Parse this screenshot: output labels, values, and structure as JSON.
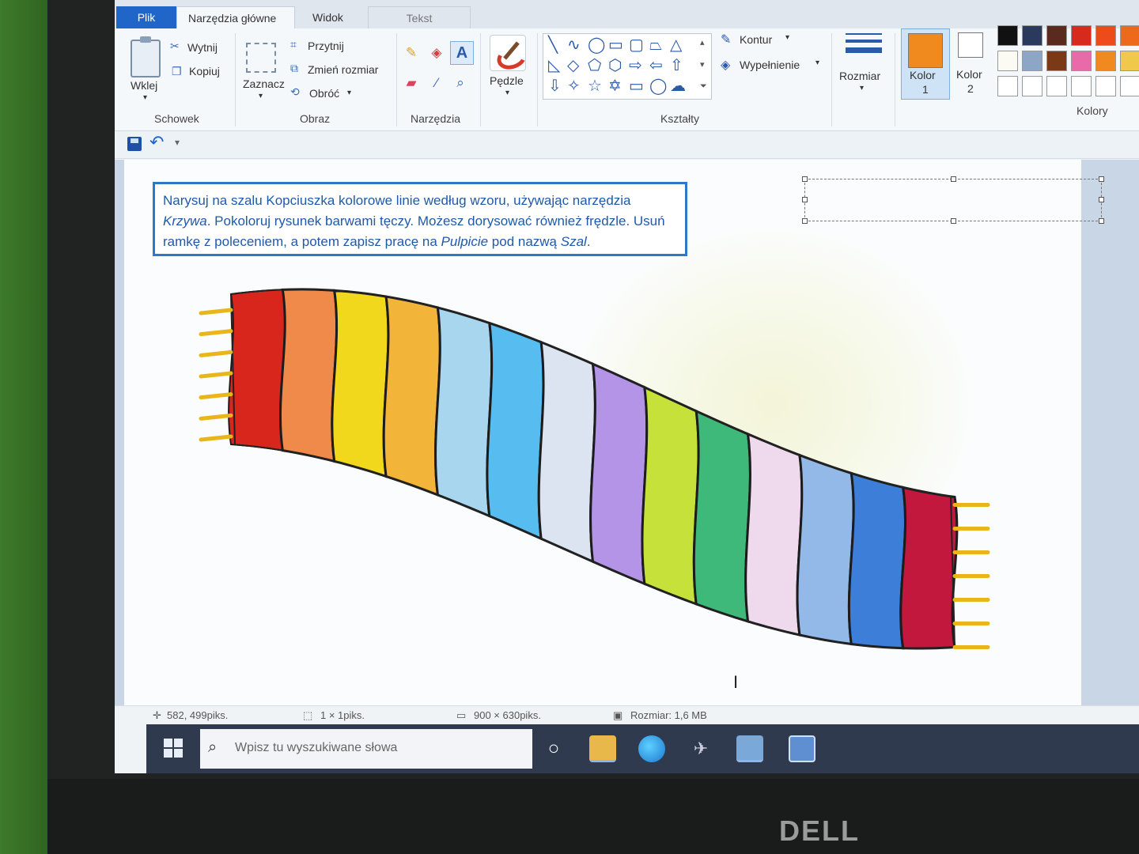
{
  "brand": "DELL",
  "tabs": {
    "file": "Plik",
    "home": "Narzędzia główne",
    "view": "Widok",
    "text": "Tekst"
  },
  "ribbon": {
    "clipboard": {
      "paste": "Wklej",
      "cut": "Wytnij",
      "copy": "Kopiuj",
      "label": "Schowek"
    },
    "image": {
      "select": "Zaznacz",
      "crop": "Przytnij",
      "resize": "Zmień rozmiar",
      "rotate": "Obróć",
      "label": "Obraz"
    },
    "tools": {
      "label": "Narzędzia",
      "text_tool": "A"
    },
    "brushes": "Pędzle",
    "shapes": {
      "outline": "Kontur",
      "fill": "Wypełnienie",
      "label": "Kształty"
    },
    "size": "Rozmiar",
    "color1": {
      "line1": "Kolor",
      "line2": "1",
      "value": "#f0891e"
    },
    "color2": {
      "line1": "Kolor",
      "line2": "2",
      "value": "#ffffff"
    },
    "colors_label": "Kolory",
    "palette": [
      "#111111",
      "#2a3a5c",
      "#5a2a1e",
      "#d62a1e",
      "#ee4b1c",
      "#ee6a1a",
      "#fbfbf3",
      "#8ea6c6",
      "#7a3a18",
      "#e96aa8",
      "#f0891e",
      "#f0c84a",
      "#ffffff",
      "#ffffff",
      "#ffffff",
      "#ffffff",
      "#ffffff",
      "#ffffff"
    ]
  },
  "canvas": {
    "instruction_part1": "Narysuj na szalu Kopciuszka kolorowe linie według wzoru, używając narzędzia ",
    "instruction_em1": "Krzywa",
    "instruction_part2": ". Pokoloruj rysunek barwami tęczy. Możesz dorysować również frędzle. Usuń ramkę z poleceniem, a potem zapisz pracę na ",
    "instruction_em2": "Pulpicie",
    "instruction_part3": " pod nazwą ",
    "instruction_em3": "Szal",
    "instruction_part4": ".",
    "scarf_stripes": [
      "#d8261c",
      "#f08a4a",
      "#f2d81c",
      "#f3b43a",
      "#a9d6ef",
      "#57bdf0",
      "#dce4f2",
      "#b394e6",
      "#c6e23a",
      "#3fb97a",
      "#efd9ec",
      "#92b9e8",
      "#3d7fd8",
      "#c2183e"
    ],
    "fringe_color": "#eab519"
  },
  "status": {
    "cursor_pos": "582, 499piks.",
    "selection": "1 × 1piks.",
    "image_size": "900 × 630piks.",
    "file_size": "Rozmiar: 1,6 MB"
  },
  "taskbar": {
    "search_placeholder": "Wpisz tu wyszukiwane słowa"
  }
}
